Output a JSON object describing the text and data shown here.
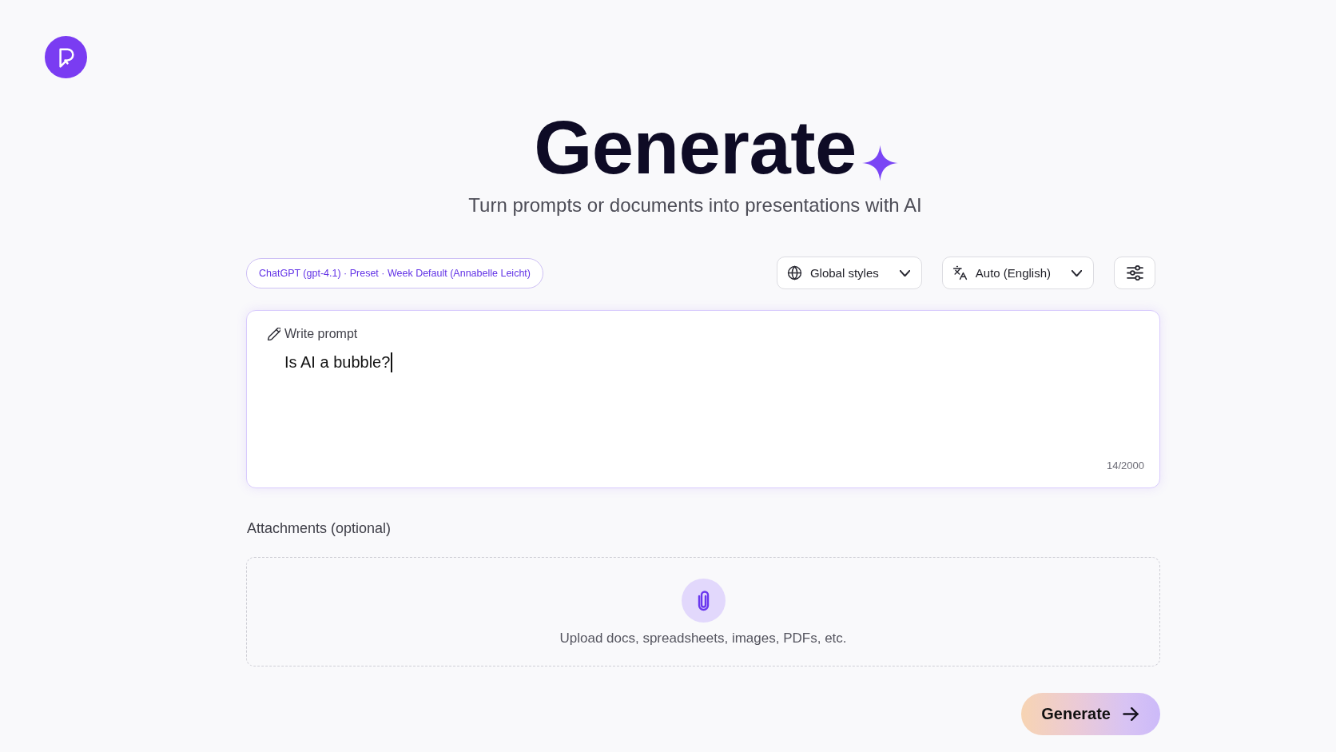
{
  "header": {
    "title": "Generate",
    "subtitle": "Turn prompts or documents into presentations with AI"
  },
  "toolbar": {
    "model_chip": "ChatGPT (gpt-4.1) · Preset · Week Default (Annabelle Leicht)",
    "dropdowns": [
      {
        "kind": "styles",
        "label": "Global styles"
      },
      {
        "kind": "language",
        "label": "Auto (English)"
      }
    ]
  },
  "prompt": {
    "label": "Write prompt",
    "value": "Is AI a bubble?",
    "focused": true,
    "counter": "14/2000"
  },
  "attachments": {
    "label": "Attachments (optional)",
    "hint": "Upload docs, spreadsheets, images, PDFs, etc."
  },
  "actions": {
    "generate": "Generate"
  }
}
